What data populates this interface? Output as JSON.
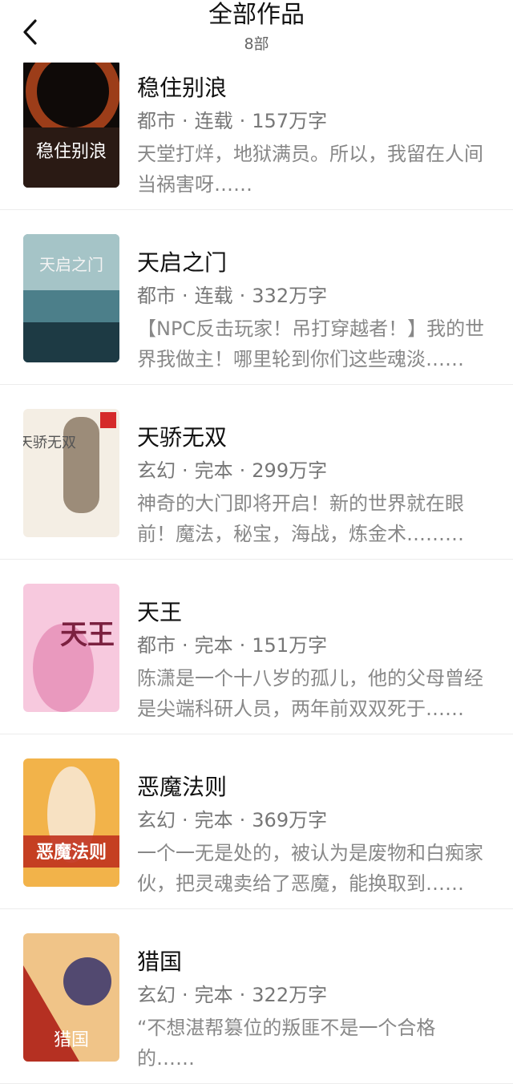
{
  "header": {
    "title": "全部作品",
    "count": "8部"
  },
  "books": [
    {
      "title": "稳住别浪",
      "genre": "都市",
      "status": "连载",
      "words": "157万字",
      "desc": "天堂打烊，地狱满员。所以，我留在人间当祸害呀……",
      "cover_text": "稳住别浪",
      "cover_colors": [
        "#2a1a14",
        "#b5471c",
        "#0f0a08"
      ]
    },
    {
      "title": "天启之门",
      "genre": "都市",
      "status": "连载",
      "words": "332万字",
      "desc": "【NPC反击玩家！吊打穿越者！】我的世界我做主！哪里轮到你们这些魂淡……",
      "cover_text": "天启之门",
      "cover_colors": [
        "#bcd6d6",
        "#4c7f8a",
        "#1d3a44"
      ]
    },
    {
      "title": "天骄无双",
      "genre": "玄幻",
      "status": "完本",
      "words": "299万字",
      "desc": "神奇的大门即将开启！新的世界就在眼前！魔法，秘宝，海战，炼金术………",
      "cover_text": "天骄无双",
      "cover_colors": [
        "#f4eee4",
        "#8c7a66",
        "#d9cbb6"
      ]
    },
    {
      "title": "天王",
      "genre": "都市",
      "status": "完本",
      "words": "151万字",
      "desc": "陈潇是一个十八岁的孤儿，他的父母曾经是尖端科研人员，两年前双双死于……",
      "cover_text": "天王",
      "cover_colors": [
        "#f7c9de",
        "#e07aa8",
        "#7b2140"
      ]
    },
    {
      "title": "恶魔法则",
      "genre": "玄幻",
      "status": "完本",
      "words": "369万字",
      "desc": "一个一无是处的，被认为是废物和白痴家伙，把灵魂卖给了恶魔，能换取到……",
      "cover_text": "恶魔法则",
      "cover_colors": [
        "#f2b34a",
        "#c0321e",
        "#5a1208"
      ]
    },
    {
      "title": "猎国",
      "genre": "玄幻",
      "status": "完本",
      "words": "322万字",
      "desc": "“不想湛帮篡位的叛匪不是一个合格的……",
      "cover_text": "猎国",
      "cover_colors": [
        "#f0c488",
        "#b53022",
        "#2b2b6a"
      ]
    }
  ]
}
